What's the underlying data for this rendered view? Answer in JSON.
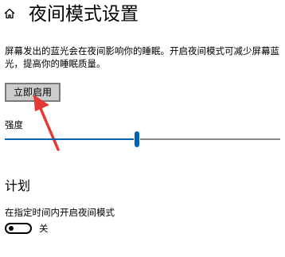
{
  "header": {
    "title": "夜间模式设置",
    "home_icon": "home-icon"
  },
  "description": "屏幕发出的蓝光会在夜间影响你的睡眠。开启夜间模式可减少屏幕蓝光，提高你的睡眠质量。",
  "enable_button": {
    "label": "立即启用"
  },
  "strength": {
    "label": "强度",
    "level_fraction": 0.48
  },
  "schedule": {
    "heading": "计划",
    "description": "在指定时间内开启夜间模式",
    "toggle_state_label": "关",
    "toggle_on": false
  },
  "colors": {
    "accent": "#0063b1",
    "annotation_arrow": "#e53935",
    "button_bg": "#cccccc"
  }
}
